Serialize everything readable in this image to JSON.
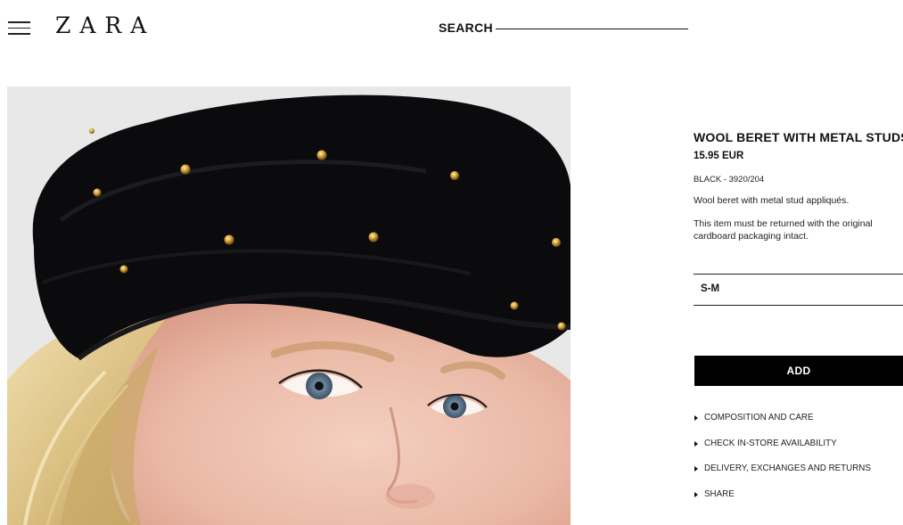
{
  "header": {
    "logo": "ZARA",
    "search_label": "SEARCH"
  },
  "product": {
    "title": "WOOL BERET WITH METAL STUDS",
    "price": "15.95 EUR",
    "color_ref": "BLACK - 3920/204",
    "description": "Wool beret with metal stud appliqués.",
    "return_note": "This item must be returned with the original cardboard packaging intact.",
    "image_icon": "product-photo"
  },
  "size_select": {
    "selected": "S-M"
  },
  "add_button": {
    "label": "ADD"
  },
  "info_links": [
    {
      "label": "COMPOSITION AND CARE"
    },
    {
      "label": "CHECK IN-STORE AVAILABILITY"
    },
    {
      "label": "DELIVERY, EXCHANGES AND RETURNS"
    },
    {
      "label": "SHARE"
    }
  ],
  "colors": {
    "primary_text": "#111111",
    "button_bg": "#000000",
    "button_text": "#ffffff",
    "background": "#ffffff"
  }
}
